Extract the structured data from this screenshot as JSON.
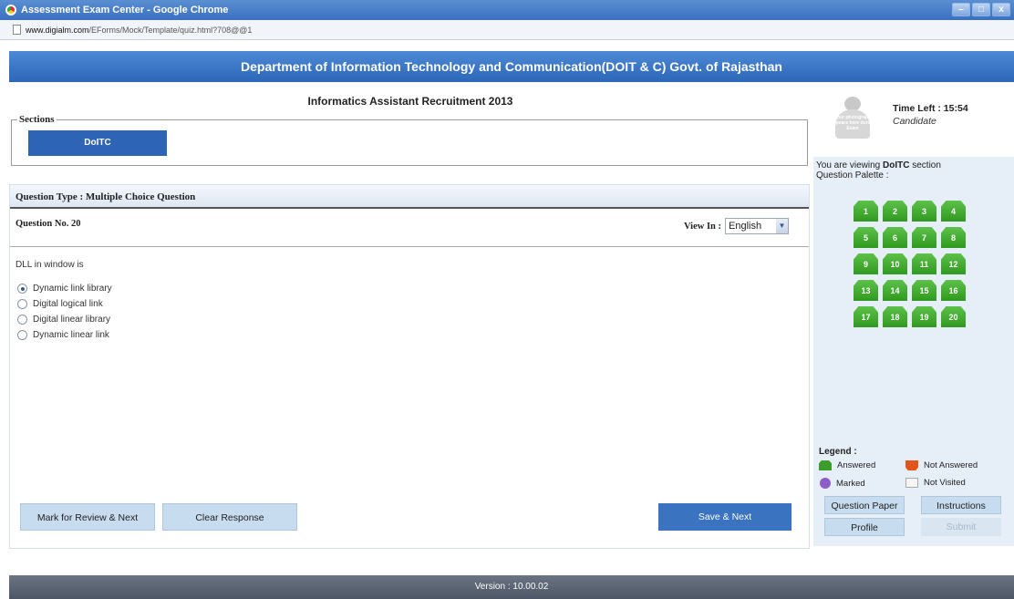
{
  "window": {
    "title": "Assessment Exam Center - Google Chrome",
    "url_host": "www.digialm.com",
    "url_path": "/EForms/Mock/Template/quiz.html?708@@1",
    "controls": {
      "minimize": "–",
      "maximize": "□",
      "close": "x"
    }
  },
  "header": {
    "department": "Department of Information Technology and Communication(DOIT & C) Govt. of Rajasthan"
  },
  "exam": {
    "title": "Informatics Assistant Recruitment 2013"
  },
  "sections": {
    "legend": "Sections",
    "active_section": "DoITC"
  },
  "question": {
    "type_label": "Question Type : Multiple Choice Question",
    "number_label": "Question No. 20",
    "view_in_label": "View In :",
    "language": "English",
    "text": "DLL in window is",
    "options": [
      {
        "label": "Dynamic link library",
        "selected": true
      },
      {
        "label": "Digital logical link",
        "selected": false
      },
      {
        "label": "Digital linear library",
        "selected": false
      },
      {
        "label": "Dynamic linear link",
        "selected": false
      }
    ]
  },
  "actions": {
    "mark_review": "Mark for Review & Next",
    "clear_response": "Clear Response",
    "save_next": "Save & Next"
  },
  "candidate": {
    "photo_text": "Your photograph appears here during Exam",
    "time_left": "Time Left : 15:54",
    "name": "Candidate"
  },
  "palette": {
    "viewing_prefix": "You are viewing ",
    "viewing_section": "DoITC",
    "viewing_suffix": " section",
    "title": "Question Palette :",
    "questions": [
      "1",
      "2",
      "3",
      "4",
      "5",
      "6",
      "7",
      "8",
      "9",
      "10",
      "11",
      "12",
      "13",
      "14",
      "15",
      "16",
      "17",
      "18",
      "19",
      "20"
    ]
  },
  "legend": {
    "title": "Legend :",
    "answered": "Answered",
    "not_answered": "Not Answered",
    "marked": "Marked",
    "not_visited": "Not Visited"
  },
  "panel_buttons": {
    "question_paper": "Question Paper",
    "instructions": "Instructions",
    "profile": "Profile",
    "submit": "Submit"
  },
  "footer": {
    "version": "Version : 10.00.02"
  },
  "colors": {
    "header_blue": "#2c66b8",
    "answered_green": "#3d9d2c",
    "not_answered_orange": "#e2561c",
    "marked_purple": "#8e5cc6",
    "palette_bg": "#e6eef7"
  }
}
